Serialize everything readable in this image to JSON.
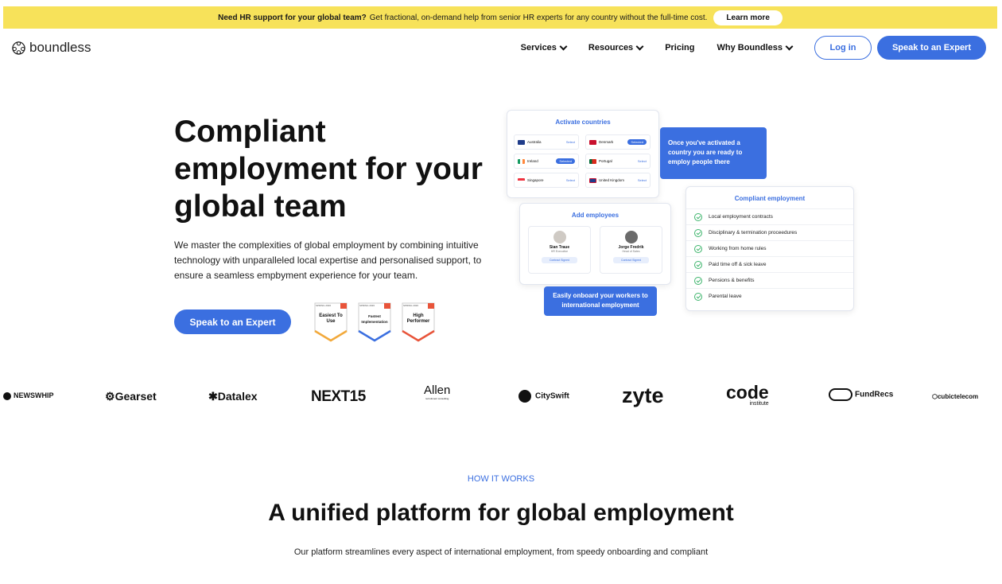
{
  "banner": {
    "bold": "Need HR support for your global team?",
    "text": "Get fractional, on-demand help from senior HR experts for any country without the full-time cost.",
    "button": "Learn more"
  },
  "brand": {
    "name": "boundless"
  },
  "nav": {
    "items": [
      "Services",
      "Resources",
      "Pricing",
      "Why Boundless"
    ],
    "login": "Log in",
    "expert": "Speak to an Expert"
  },
  "hero": {
    "title": "Compliant employment for your global team",
    "description": "We master the complexities of global employment by combining intuitive technology with unparalleled local expertise and personalised support, to ensure a seamless empbyment experience for your team.",
    "cta": "Speak to an Expert"
  },
  "badges": [
    {
      "top": "SPRING 2026",
      "label": "Easiest To Use",
      "color": "#f2a93b"
    },
    {
      "top": "SPRING 2026",
      "label": "Fastest Implementation",
      "color": "#3b6fe0"
    },
    {
      "top": "SPRING 2026",
      "label": "High Performer",
      "color": "#e8543a"
    }
  ],
  "illustration": {
    "activate_title": "Activate countries",
    "countries": [
      {
        "name": "Australia",
        "action": "Select",
        "flag": "#1f3c8a"
      },
      {
        "name": "Denmark",
        "action": "Selected",
        "flag": "#c8102e"
      },
      {
        "name": "Ireland",
        "action": "Selected",
        "flag": "#169b62"
      },
      {
        "name": "Portugal",
        "action": "Select",
        "flag": "#046a38"
      },
      {
        "name": "Singapore",
        "action": "Select",
        "flag": "#ffffff"
      },
      {
        "name": "United Kingdom",
        "action": "Select",
        "flag": "#1f3c8a"
      }
    ],
    "activate_note": "Once you've activated a country you are ready to employ people there",
    "add_title": "Add employees",
    "employees": [
      {
        "name": "Sian Traue",
        "role": "HR Executive",
        "status": "Contract Signed"
      },
      {
        "name": "Jorge Fredrik",
        "role": "Head of Sales",
        "status": "Contract Signed"
      }
    ],
    "onboard_note": "Easily onboard your workers to international employment",
    "compliant_title": "Compliant employment",
    "compliant_items": [
      "Local employment contracts",
      "Disciplinary & termination proceedures",
      "Working from home rules",
      "Paid time off & sick leave",
      "Pensions & benefits",
      "Parental leave"
    ]
  },
  "logos": [
    "NEWSWHIP",
    "Gearset",
    "Datalex",
    "NEXT15",
    "Allen",
    "CitySwift",
    "zyte",
    "code",
    "FundRecs",
    "cubictelecom"
  ],
  "logo_subs": {
    "allen": "recruitment consulting",
    "code": "institute"
  },
  "section": {
    "eyebrow": "HOW IT WORKS",
    "title": "A unified platform for global employment",
    "text": "Our platform streamlines every aspect of international employment, from speedy onboarding and compliant"
  }
}
